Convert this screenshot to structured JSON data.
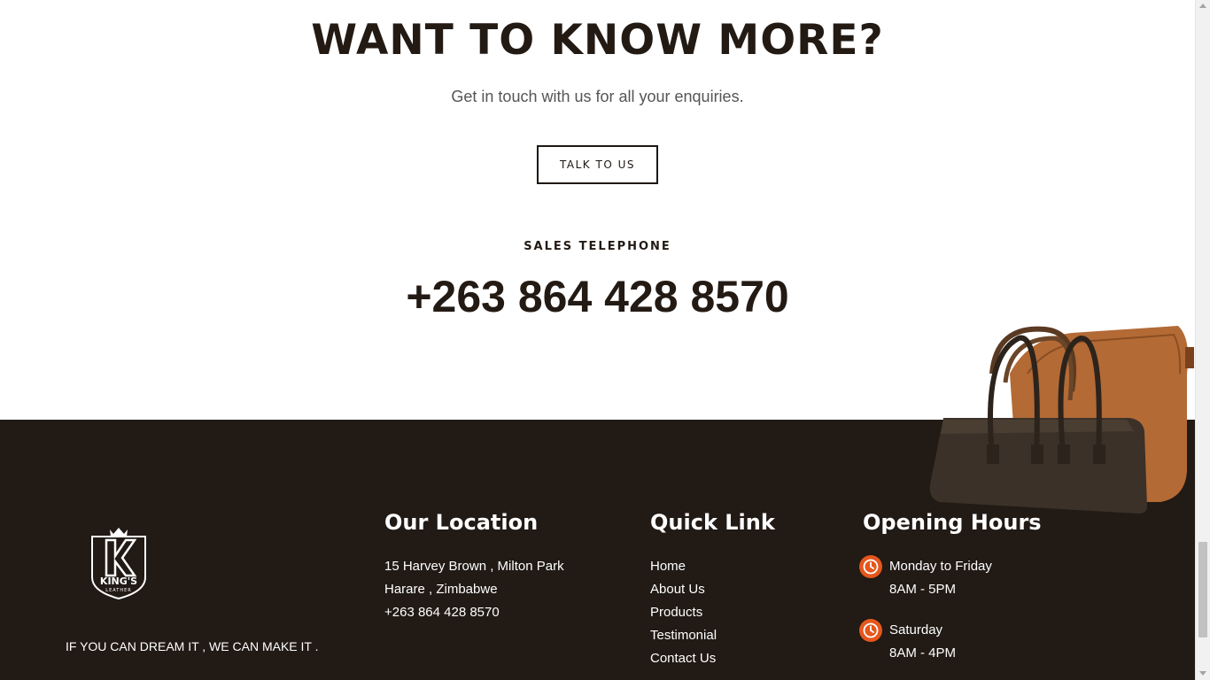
{
  "cta": {
    "title": "WANT TO KNOW MORE?",
    "subtitle": "Get in touch with us for all your enquiries.",
    "button_label": "TALK TO US",
    "sales_label": "SALES TELEPHONE",
    "sales_phone": "+263 864 428 8570"
  },
  "footer": {
    "tagline": "IF YOU CAN DREAM IT , WE CAN MAKE IT .",
    "logo_text": "KING'S",
    "logo_subtext": "LEATHER",
    "location": {
      "title": "Our Location",
      "line1": "15 Harvey Brown , Milton Park",
      "line2": "Harare , Zimbabwe",
      "phone": "+263 864 428 8570"
    },
    "quick_links": {
      "title": "Quick Link",
      "items": [
        "Home",
        "About Us",
        "Products",
        "Testimonial",
        "Contact Us"
      ]
    },
    "hours": {
      "title": "Opening Hours",
      "entries": [
        {
          "days": "Monday to Friday",
          "time": "8AM - 5PM"
        },
        {
          "days": "Saturday",
          "time": "8AM - 4PM"
        }
      ]
    }
  },
  "colors": {
    "footer_bg": "#211a15",
    "accent": "#e4571c",
    "text_dark": "#231a14"
  }
}
